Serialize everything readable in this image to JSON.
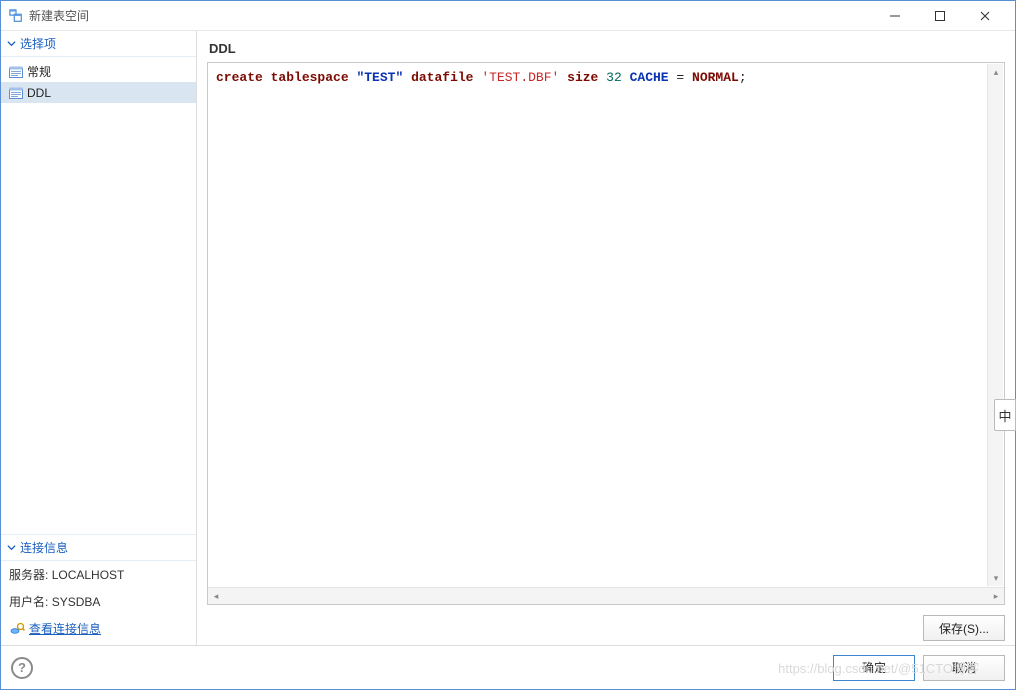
{
  "window": {
    "title": "新建表空间"
  },
  "sidebar": {
    "options_header": "选择项",
    "items": [
      {
        "label": "常规",
        "selected": false
      },
      {
        "label": "DDL",
        "selected": true
      }
    ],
    "conn_header": "连接信息",
    "server_label": "服务器:",
    "server_value": "LOCALHOST",
    "user_label": "用户名:",
    "user_value": "SYSDBA",
    "view_conn": "查看连接信息"
  },
  "main": {
    "heading": "DDL",
    "code_tokens": [
      {
        "t": "kw",
        "v": "create"
      },
      {
        "t": "sp",
        "v": " "
      },
      {
        "t": "kw",
        "v": "tablespace"
      },
      {
        "t": "sp",
        "v": " "
      },
      {
        "t": "ident",
        "v": "\"TEST\""
      },
      {
        "t": "sp",
        "v": " "
      },
      {
        "t": "kw",
        "v": "datafile"
      },
      {
        "t": "sp",
        "v": " "
      },
      {
        "t": "str",
        "v": "'TEST.DBF'"
      },
      {
        "t": "sp",
        "v": " "
      },
      {
        "t": "kw",
        "v": "size"
      },
      {
        "t": "sp",
        "v": " "
      },
      {
        "t": "num",
        "v": "32"
      },
      {
        "t": "sp",
        "v": " "
      },
      {
        "t": "ident",
        "v": "CACHE"
      },
      {
        "t": "sp",
        "v": " "
      },
      {
        "t": "norm",
        "v": "= "
      },
      {
        "t": "kw",
        "v": "NORMAL"
      },
      {
        "t": "norm",
        "v": ";"
      }
    ],
    "save_button": "保存(S)..."
  },
  "footer": {
    "ok": "确定",
    "cancel": "取消"
  },
  "right_tab": "中",
  "watermark": "https://blog.csdn.net/@51CTO博客"
}
